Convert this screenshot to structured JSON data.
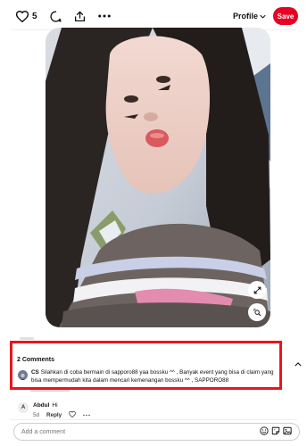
{
  "toolbar": {
    "like_count": "5",
    "profile_label": "Profile",
    "save_label": "Save"
  },
  "comments": {
    "title": "2 Comments",
    "items": [
      {
        "author": "CS",
        "text": "Silahkan di coba bermain di sapporo88 yaa bossku ^^ , Banyak event yang bisa di claim yang bisa mempermudah kita dalam mencari kemenangan bossku ^^ , SAPPORO88"
      },
      {
        "author": "Abdul",
        "text": "Hi",
        "time": "5d",
        "reply_label": "Reply",
        "avatar_letter": "A"
      }
    ]
  },
  "composer": {
    "placeholder": "Add a comment"
  },
  "colors": {
    "accent": "#e60023",
    "highlight_box": "#e8161d"
  }
}
